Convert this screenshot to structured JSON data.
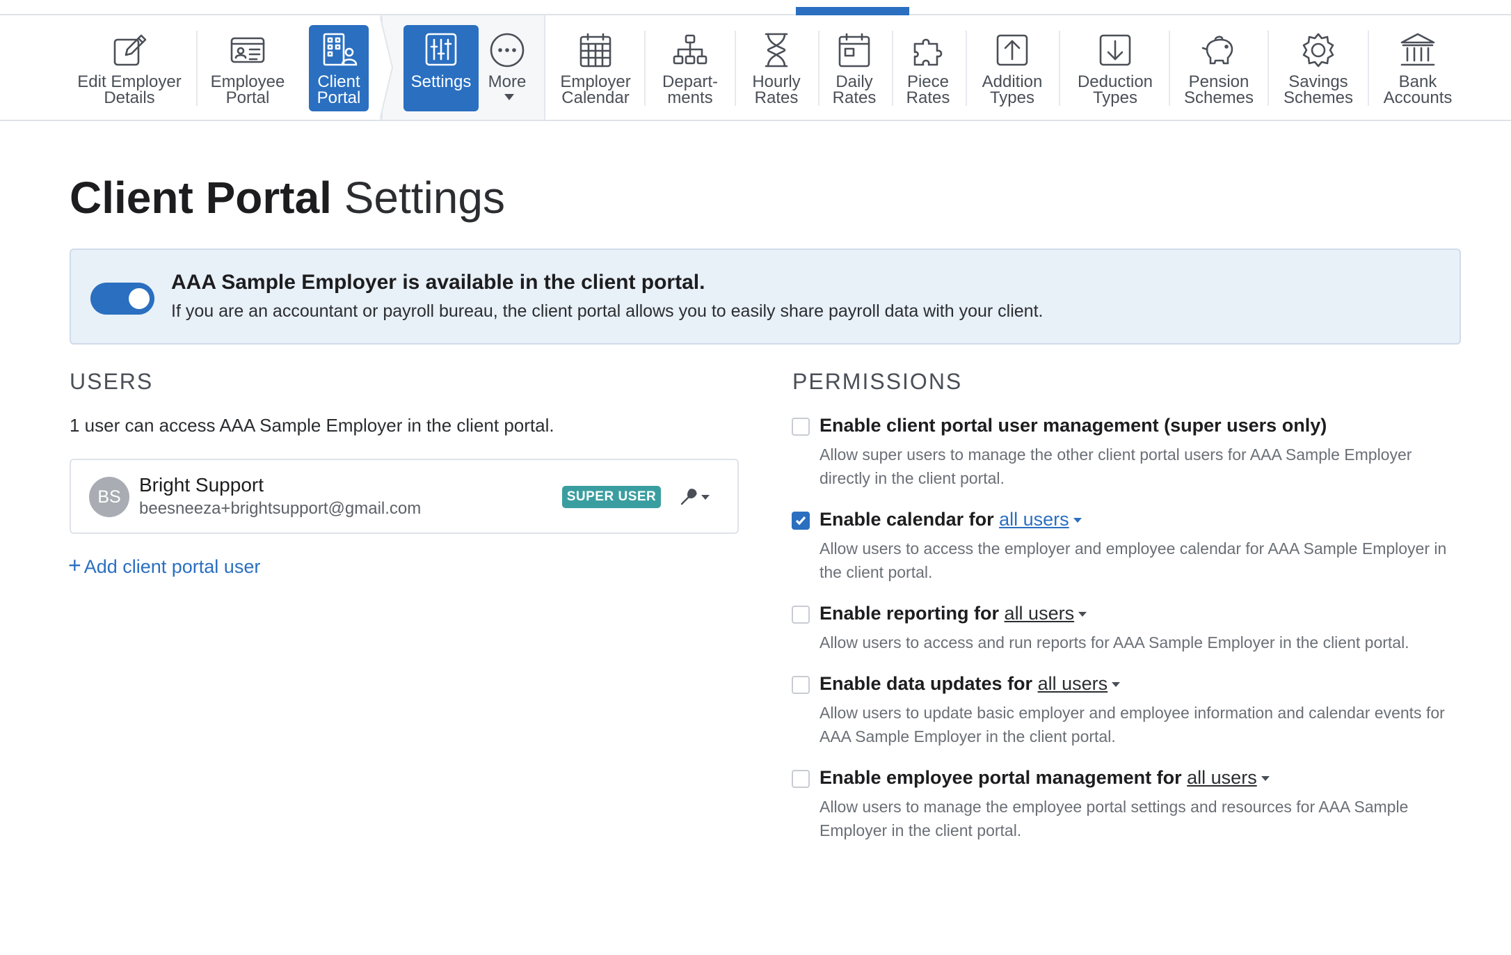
{
  "toolbar": {
    "items": [
      {
        "label": "Edit Employer\nDetails",
        "icon": "edit-icon"
      },
      {
        "label": "Employee\nPortal",
        "icon": "id-card-icon"
      },
      {
        "label": "Client\nPortal",
        "icon": "building-user-icon"
      },
      {
        "label": "Settings",
        "icon": "sliders-icon"
      },
      {
        "label": "More",
        "icon": "more-icon"
      },
      {
        "label": "Employer\nCalendar",
        "icon": "calendar-icon"
      },
      {
        "label": "Depart-\nments",
        "icon": "org-chart-icon"
      },
      {
        "label": "Hourly\nRates",
        "icon": "hourglass-icon"
      },
      {
        "label": "Daily\nRates",
        "icon": "day-calendar-icon"
      },
      {
        "label": "Piece\nRates",
        "icon": "puzzle-icon"
      },
      {
        "label": "Addition\nTypes",
        "icon": "arrow-up-box-icon"
      },
      {
        "label": "Deduction\nTypes",
        "icon": "arrow-down-box-icon"
      },
      {
        "label": "Pension\nSchemes",
        "icon": "piggy-bank-icon"
      },
      {
        "label": "Savings\nSchemes",
        "icon": "badge-icon"
      },
      {
        "label": "Bank\nAccounts",
        "icon": "bank-icon"
      }
    ]
  },
  "page": {
    "title_strong": "Client Portal",
    "title_light": "Settings"
  },
  "banner": {
    "title": "AAA Sample Employer is available in the client portal.",
    "subtitle": "If you are an accountant or payroll bureau, the client portal allows you to easily share payroll data with your client.",
    "toggle_on": true
  },
  "users": {
    "heading": "USERS",
    "count_text": "1 user can access AAA Sample Employer in the client portal.",
    "list": [
      {
        "initials": "BS",
        "name": "Bright Support",
        "email": "beesneeza+brightsupport@gmail.com",
        "badge": "SUPER USER"
      }
    ],
    "add_label": "Add client portal user"
  },
  "permissions": {
    "heading": "PERMISSIONS",
    "items": [
      {
        "title": "Enable client portal user management (super users only)",
        "link": "",
        "checked": false,
        "desc": "Allow super users to manage the other client portal users for AAA Sample Employer directly in the client portal."
      },
      {
        "title": "Enable calendar for",
        "link": "all users",
        "checked": true,
        "desc": "Allow users to access the employer and employee calendar for AAA Sample Employer in the client portal."
      },
      {
        "title": "Enable reporting for",
        "link": "all users",
        "checked": false,
        "desc": "Allow users to access and run reports for AAA Sample Employer in the client portal."
      },
      {
        "title": "Enable data updates for",
        "link": "all users",
        "checked": false,
        "desc": "Allow users to update basic employer and employee information and calendar events for AAA Sample Employer in the client portal."
      },
      {
        "title": "Enable employee portal management for",
        "link": "all users",
        "checked": false,
        "desc": "Allow users to manage the employee portal settings and resources for AAA Sample Employer in the client portal."
      }
    ]
  },
  "colors": {
    "accent": "#2a6fc0",
    "badge": "#3a9ea0",
    "banner_bg": "#e8f0f8"
  }
}
